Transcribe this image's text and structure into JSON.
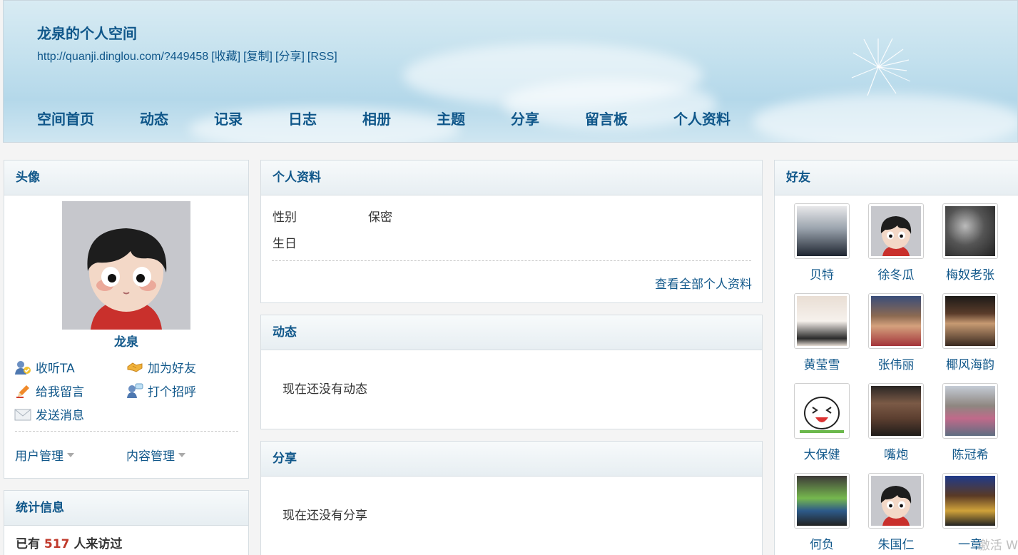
{
  "header": {
    "title": "龙泉的个人空间",
    "url": "http://quanji.dinglou.com/?449458",
    "url_actions": [
      "[收藏]",
      "[复制]",
      "[分享]",
      "[RSS]"
    ],
    "nav": [
      "空间首页",
      "动态",
      "记录",
      "日志",
      "相册",
      "主题",
      "分享",
      "留言板",
      "个人资料"
    ]
  },
  "avatar_panel": {
    "title": "头像",
    "name": "龙泉",
    "actions": [
      {
        "label": "收听TA",
        "icon": "follow-icon"
      },
      {
        "label": "加为好友",
        "icon": "handshake-icon"
      },
      {
        "label": "给我留言",
        "icon": "pencil-icon"
      },
      {
        "label": "打个招呼",
        "icon": "greet-icon"
      },
      {
        "label": "发送消息",
        "icon": "envelope-icon"
      }
    ],
    "user_mgmt": "用户管理",
    "content_mgmt": "内容管理"
  },
  "stats_panel": {
    "title": "统计信息",
    "prefix": "已有",
    "count": "517",
    "suffix": "人来访过"
  },
  "profile_panel": {
    "title": "个人资料",
    "rows": [
      {
        "label": "性别",
        "value": "保密"
      },
      {
        "label": "生日",
        "value": ""
      }
    ],
    "view_all": "查看全部个人资料"
  },
  "activity_panel": {
    "title": "动态",
    "empty": "现在还没有动态"
  },
  "share_panel": {
    "title": "分享",
    "empty": "现在还没有分享"
  },
  "friends_panel": {
    "title": "好友",
    "friends": [
      "贝特",
      "徐冬瓜",
      "梅奴老张",
      "黄莹雪",
      "张伟丽",
      "椰风海韵",
      "大保健",
      "嘴炮",
      "陈冠希",
      "何负",
      "朱国仁",
      "一章"
    ]
  },
  "watermark": "激活 W",
  "colors": {
    "link": "#10578a",
    "count": "#c0392b"
  }
}
